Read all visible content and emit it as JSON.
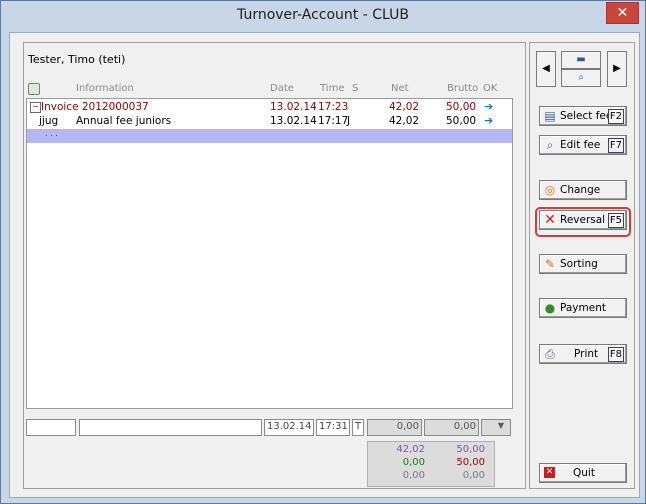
{
  "window": {
    "title": "Turnover-Account - CLUB",
    "close_symbol": "✕"
  },
  "person": "Tester, Timo (teti)",
  "columns": [
    "Information",
    "Date",
    "Time",
    "S",
    "Net",
    "Brutto",
    "OK"
  ],
  "rows": [
    {
      "code": "Invoice 2012000037",
      "info": "",
      "date": "13.02.14",
      "time": "17:23",
      "s": "",
      "net": "42,02",
      "brutto": "50,00",
      "ok": "➔"
    },
    {
      "code": "jjug",
      "info": "Annual fee juniors",
      "date": "13.02.14",
      "time": "17:17",
      "s": "J",
      "net": "42,02",
      "brutto": "50,00",
      "ok": "➔"
    }
  ],
  "selected_dots": ". . .",
  "input_row": {
    "code": "",
    "info": "",
    "date": "13.02.14",
    "time": "17:31",
    "s": "T",
    "net": "0,00",
    "brutto": "0,00"
  },
  "totals": {
    "net": [
      "42,02",
      "0,00",
      "0,00"
    ],
    "brutto": [
      "50,00",
      "50,00",
      "0,00"
    ]
  },
  "buttons": {
    "select_fee": {
      "label": "Select fee",
      "key": "F2"
    },
    "edit_fee": {
      "label": "Edit fee",
      "key": "F7"
    },
    "change": {
      "label": "Change"
    },
    "reversal": {
      "label": "Reversal",
      "key": "F5"
    },
    "sorting": {
      "label": "Sorting"
    },
    "payment": {
      "label": "Payment"
    },
    "print": {
      "label": "Print",
      "key": "F8"
    },
    "quit": {
      "label": "Quit"
    }
  },
  "colors": {
    "accent_red": "#d43a3a",
    "selected_row": "#b6b8f5",
    "invoice_text": "#8b0000",
    "arrow": "#1478c8"
  }
}
